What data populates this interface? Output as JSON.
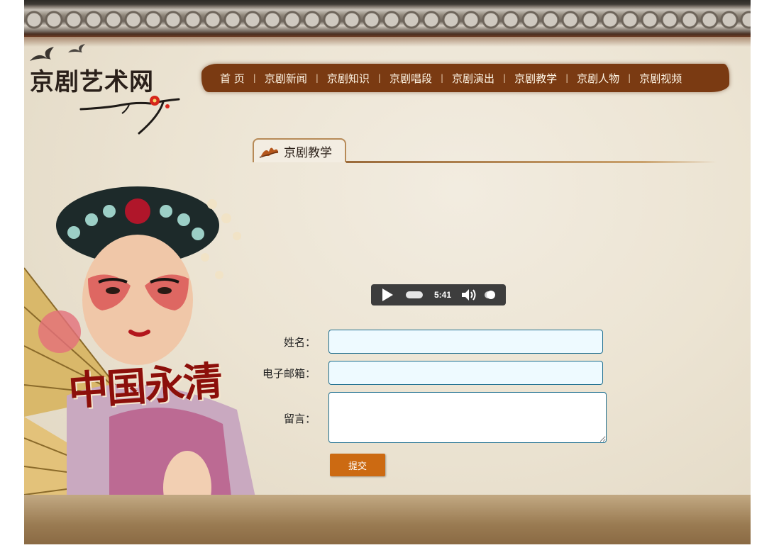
{
  "site": {
    "logo_title": "京剧艺术网"
  },
  "nav": {
    "items": [
      {
        "label": "首 页"
      },
      {
        "label": "京剧新闻"
      },
      {
        "label": "京剧知识"
      },
      {
        "label": "京剧唱段"
      },
      {
        "label": "京剧演出"
      },
      {
        "label": "京剧教学"
      },
      {
        "label": "京剧人物"
      },
      {
        "label": "京剧视频"
      }
    ],
    "separator": "|"
  },
  "section": {
    "tab_label": "京剧教学"
  },
  "audio_player": {
    "time": "5:41",
    "progress_fraction": 0.0
  },
  "form": {
    "name_label": "姓名：",
    "email_label": "电子邮箱：",
    "message_label": "留言：",
    "submit_label": "提交",
    "name_value": "",
    "email_value": "",
    "message_value": ""
  },
  "banner": {
    "calligraphy_text": "中国永清"
  },
  "colors": {
    "nav_background": "#7a3a12",
    "submit_button": "#cc6a12",
    "input_border": "#1f6f8f",
    "input_background": "#eefaff",
    "player_background": "#3d3d3d"
  },
  "icons": [
    "birds-icon",
    "plum-branch-icon",
    "tab-flower-icon",
    "play-icon",
    "volume-icon"
  ]
}
